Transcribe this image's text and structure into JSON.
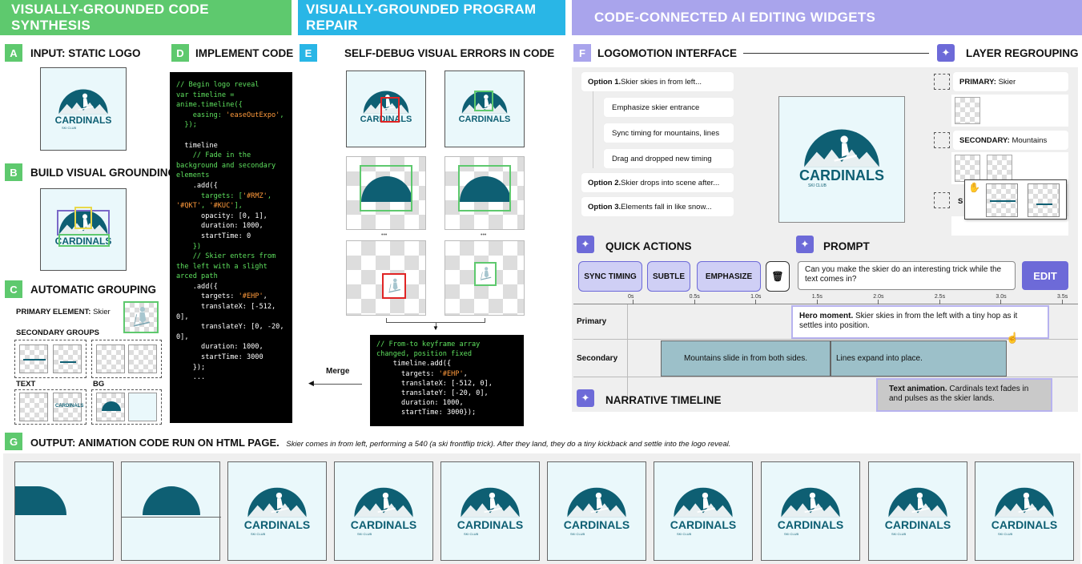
{
  "headers": {
    "h1": "VISUALLY-GROUNDED CODE SYNTHESIS",
    "h2": "VISUALLY-GROUNDED PROGRAM REPAIR",
    "h3": "CODE-CONNECTED AI EDITING WIDGETS"
  },
  "colors": {
    "green": "#5ec96e",
    "cyan": "#29b6e6",
    "purple": "#a9a4ec",
    "accent": "#6d6ad8",
    "teal": "#0e5f73",
    "slate": "#9cc0c9"
  },
  "logo": {
    "name": "CARDINALS",
    "sub": "SKI CLUB"
  },
  "a": {
    "badge": "A",
    "title": "INPUT: STATIC LOGO"
  },
  "b": {
    "badge": "B",
    "title": "BUILD VISUAL GROUNDING"
  },
  "c": {
    "badge": "C",
    "title": "AUTOMATIC GROUPING",
    "primary_label": "PRIMARY ELEMENT:",
    "primary_value": "Skier",
    "secondary": "SECONDARY GROUPS",
    "text": "TEXT",
    "bg": "BG"
  },
  "d": {
    "badge": "D",
    "title": "IMPLEMENT CODE"
  },
  "e": {
    "badge": "E",
    "title": "SELF-DEBUG VISUAL ERRORS IN CODE",
    "merge": "Merge",
    "dots": "•••"
  },
  "f": {
    "badge": "F",
    "title": "LOGOMOTION INTERFACE",
    "options": [
      {
        "bold": "Option 1.",
        "text": " Skier skies in from left..."
      },
      {
        "bold": "",
        "text": "Emphasize skier entrance"
      },
      {
        "bold": "",
        "text": "Sync timing for mountains, lines"
      },
      {
        "bold": "",
        "text": "Drag and dropped new timing"
      },
      {
        "bold": "Option 2.",
        "text": " Skier drops into scene after..."
      },
      {
        "bold": "Option 3.",
        "text": " Elements fall in like snow..."
      }
    ],
    "layer_title": "LAYER REGROUPING",
    "primary_label": "PRIMARY:",
    "primary_value": "Skier",
    "secondary_label": "SECONDARY:",
    "secondary_value": "Mountains",
    "s_cut": "S",
    "quick_title": "QUICK ACTIONS",
    "btn_sync": "SYNC TIMING",
    "btn_subtle": "SUBTLE",
    "btn_emph": "EMPHASIZE",
    "prompt_title": "PROMPT",
    "prompt_text": "Can you make the skier do an interesting trick while the text comes in?",
    "btn_edit": "EDIT",
    "ticks": [
      "0s",
      "0.5s",
      "1.0s",
      "1.5s",
      "2.0s",
      "2.5s",
      "3.0s",
      "3.5s"
    ],
    "row_primary": "Primary",
    "row_secondary": "Secondary",
    "narrative": "NARRATIVE TIMELINE",
    "hero_bold": "Hero moment.",
    "hero_text": " Skier skies in from the left with a tiny hop as it settles into position.",
    "mountains": "Mountains slide in from both sides.",
    "lines": "Lines expand into place.",
    "text_bold": "Text animation.",
    "text_text": " Cardinals text fades in and pulses as the skier lands."
  },
  "g": {
    "badge": "G",
    "title": "OUTPUT: ANIMATION CODE RUN ON HTML PAGE.",
    "caption": "Skier comes in from left, performing a 540 (a ski frontflip trick). After they land, they do a tiny kickback and settle into the logo reveal."
  }
}
